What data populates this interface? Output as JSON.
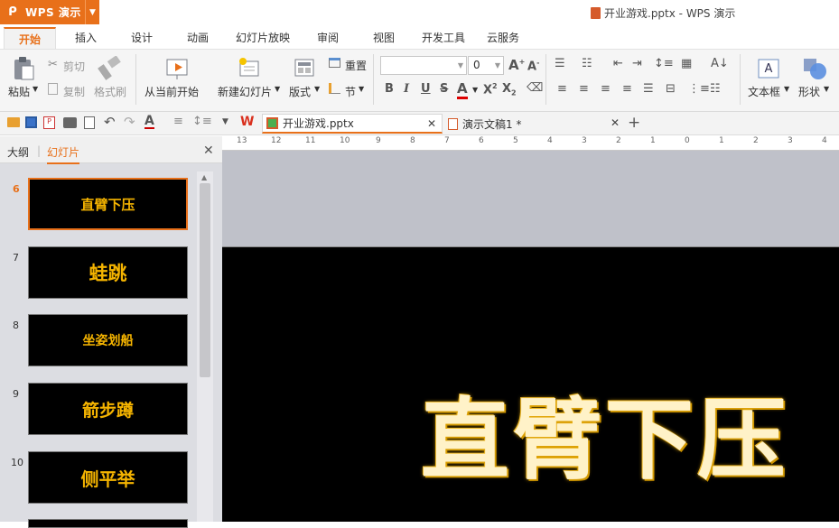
{
  "app": {
    "name": "WPS 演示",
    "doc_title": "开业游戏.pptx - WPS 演示"
  },
  "ribbon_tabs": [
    "开始",
    "插入",
    "设计",
    "动画",
    "幻灯片放映",
    "审阅",
    "视图",
    "开发工具",
    "云服务"
  ],
  "ribbon": {
    "paste": "粘贴",
    "cut": "剪切",
    "copy": "复制",
    "format_painter": "格式刷",
    "from_current": "从当前开始",
    "new_slide": "新建幻灯片",
    "layout": "版式",
    "reset": "重置",
    "section": "节",
    "font_size": "0",
    "textbox": "文本框",
    "shape": "形状"
  },
  "doc_tabs": [
    {
      "label": "开业游戏.pptx",
      "active": true
    },
    {
      "label": "演示文稿1 *",
      "active": false
    }
  ],
  "panel": {
    "outline_tab": "大纲",
    "slides_tab": "幻灯片"
  },
  "slides": [
    {
      "num": "6",
      "title": "直臂下压",
      "selected": true
    },
    {
      "num": "7",
      "title": "蛙跳",
      "selected": false
    },
    {
      "num": "8",
      "title": "坐姿划船",
      "selected": false
    },
    {
      "num": "9",
      "title": "箭步蹲",
      "selected": false
    },
    {
      "num": "10",
      "title": "侧平举",
      "selected": false
    }
  ],
  "ruler_ticks": [
    "13",
    "12",
    "11",
    "10",
    "9",
    "8",
    "7",
    "6",
    "5",
    "4",
    "3",
    "2",
    "1",
    "0",
    "1",
    "2",
    "3",
    "4"
  ],
  "slide": {
    "title": "直臂下压"
  },
  "colors": {
    "accent": "#e8701a",
    "thumb_text": "#f5b400"
  }
}
